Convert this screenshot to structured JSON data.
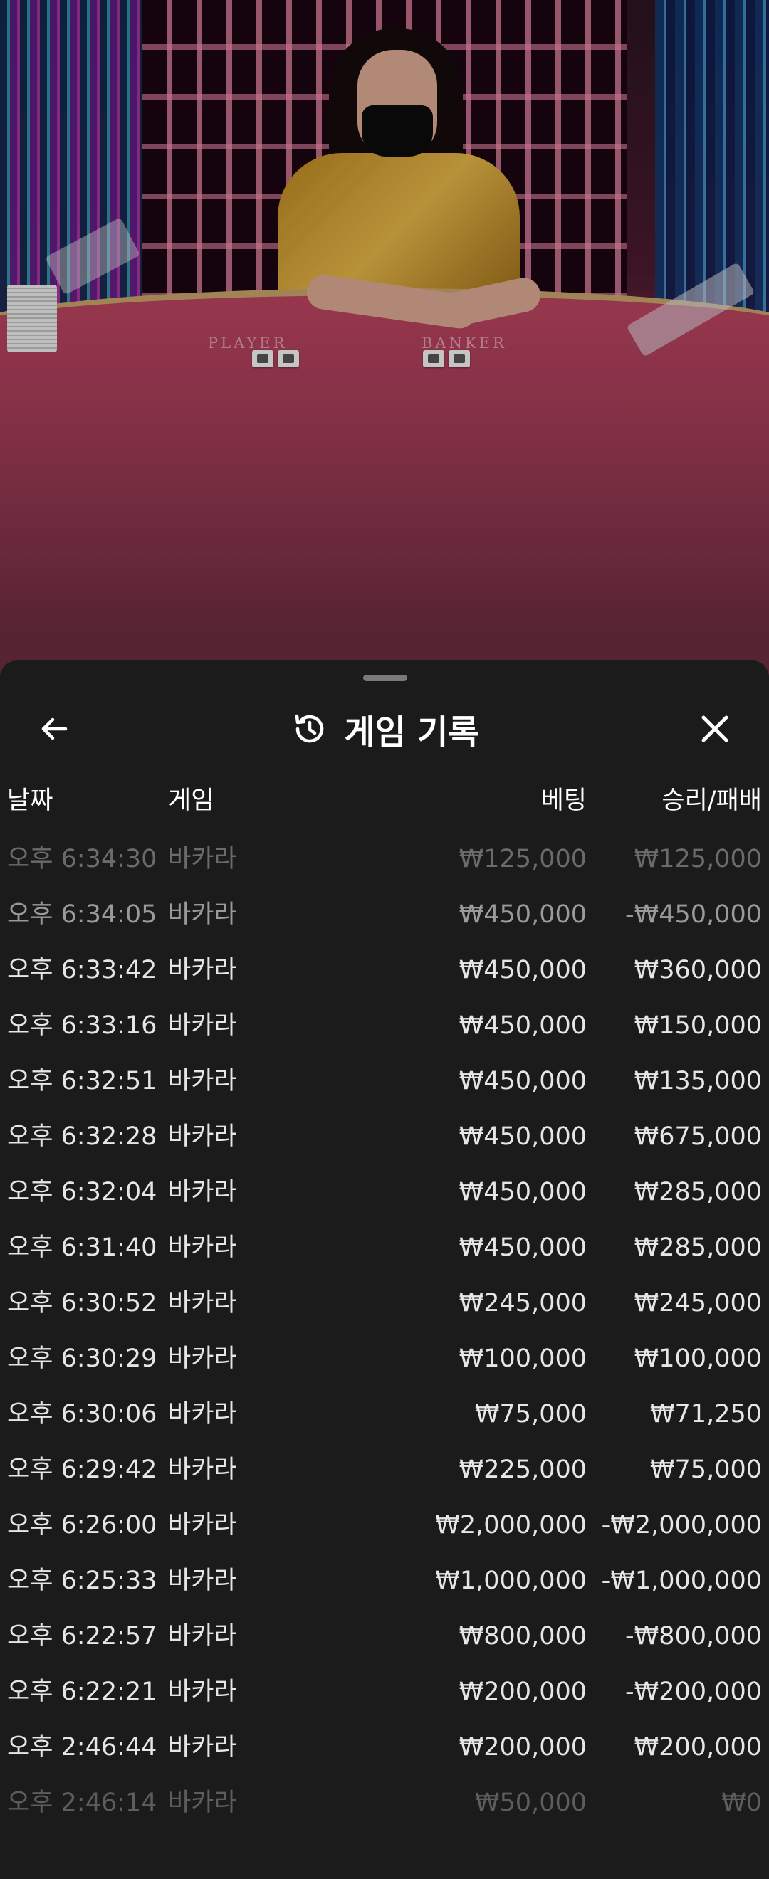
{
  "video": {
    "felt_labels": {
      "player": "PLAYER",
      "banker": "BANKER"
    }
  },
  "panel": {
    "title": "게임 기록",
    "title_icon": "history-icon",
    "back_icon": "arrow-left-icon",
    "close_icon": "close-icon"
  },
  "table": {
    "headers": {
      "date": "날짜",
      "game": "게임",
      "bet": "베팅",
      "winloss": "승리/패배"
    },
    "rows": [
      {
        "time": "오후 6:34:30",
        "game": "바카라",
        "bet": "₩125,000",
        "result": "₩125,000"
      },
      {
        "time": "오후 6:34:05",
        "game": "바카라",
        "bet": "₩450,000",
        "result": "-₩450,000"
      },
      {
        "time": "오후 6:33:42",
        "game": "바카라",
        "bet": "₩450,000",
        "result": "₩360,000"
      },
      {
        "time": "오후 6:33:16",
        "game": "바카라",
        "bet": "₩450,000",
        "result": "₩150,000"
      },
      {
        "time": "오후 6:32:51",
        "game": "바카라",
        "bet": "₩450,000",
        "result": "₩135,000"
      },
      {
        "time": "오후 6:32:28",
        "game": "바카라",
        "bet": "₩450,000",
        "result": "₩675,000"
      },
      {
        "time": "오후 6:32:04",
        "game": "바카라",
        "bet": "₩450,000",
        "result": "₩285,000"
      },
      {
        "time": "오후 6:31:40",
        "game": "바카라",
        "bet": "₩450,000",
        "result": "₩285,000"
      },
      {
        "time": "오후 6:30:52",
        "game": "바카라",
        "bet": "₩245,000",
        "result": "₩245,000"
      },
      {
        "time": "오후 6:30:29",
        "game": "바카라",
        "bet": "₩100,000",
        "result": "₩100,000"
      },
      {
        "time": "오후 6:30:06",
        "game": "바카라",
        "bet": "₩75,000",
        "result": "₩71,250"
      },
      {
        "time": "오후 6:29:42",
        "game": "바카라",
        "bet": "₩225,000",
        "result": "₩75,000"
      },
      {
        "time": "오후 6:26:00",
        "game": "바카라",
        "bet": "₩2,000,000",
        "result": "-₩2,000,000"
      },
      {
        "time": "오후 6:25:33",
        "game": "바카라",
        "bet": "₩1,000,000",
        "result": "-₩1,000,000"
      },
      {
        "time": "오후 6:22:57",
        "game": "바카라",
        "bet": "₩800,000",
        "result": "-₩800,000"
      },
      {
        "time": "오후 6:22:21",
        "game": "바카라",
        "bet": "₩200,000",
        "result": "-₩200,000"
      },
      {
        "time": "오후 2:46:44",
        "game": "바카라",
        "bet": "₩200,000",
        "result": "₩200,000"
      },
      {
        "time": "오후 2:46:14",
        "game": "바카라",
        "bet": "₩50,000",
        "result": "₩0"
      }
    ]
  },
  "colors": {
    "panel_bg": "#1b1b1b",
    "text": "#e6e6e6",
    "dim_text": "#6b6b6b"
  }
}
